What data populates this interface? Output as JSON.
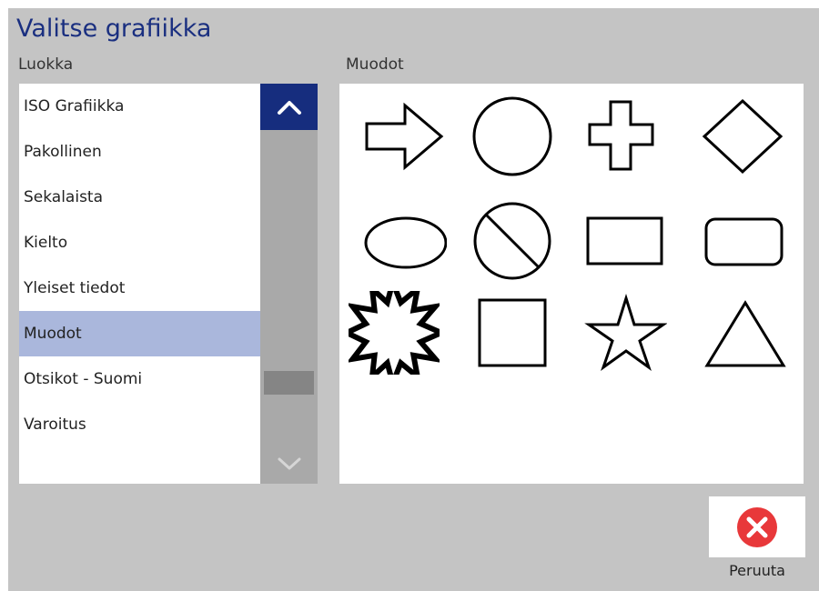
{
  "dialog": {
    "title": "Valitse grafiikka"
  },
  "category": {
    "label": "Luokka",
    "items": [
      {
        "label": "ISO Grafiikka",
        "selected": false
      },
      {
        "label": "Pakollinen",
        "selected": false
      },
      {
        "label": "Sekalaista",
        "selected": false
      },
      {
        "label": "Kielto",
        "selected": false
      },
      {
        "label": "Yleiset tiedot",
        "selected": false
      },
      {
        "label": "Muodot",
        "selected": true
      },
      {
        "label": "Otsikot - Suomi",
        "selected": false
      },
      {
        "label": "Varoitus",
        "selected": false
      }
    ]
  },
  "shapes": {
    "label": "Muodot",
    "items": [
      "arrow-right",
      "circle",
      "cross",
      "diamond",
      "ellipse",
      "prohibition-circle",
      "rectangle",
      "rounded-rectangle",
      "starburst",
      "square",
      "star",
      "triangle"
    ]
  },
  "cancel": {
    "label": "Peruuta",
    "icon": "close-icon",
    "icon_color": "#e8383a"
  },
  "colors": {
    "title": "#1a2f80",
    "selected_row": "#aab7dc",
    "scroll_up_bg": "#162d7e",
    "background": "#c4c4c4"
  }
}
